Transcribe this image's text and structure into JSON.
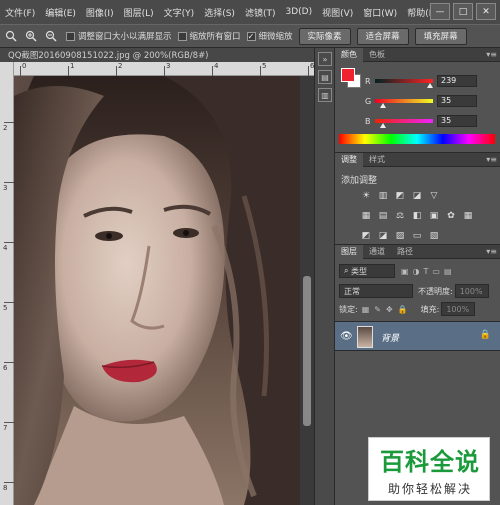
{
  "menu": {
    "items": [
      "文件(F)",
      "编辑(E)",
      "图像(I)",
      "图层(L)",
      "文字(Y)",
      "选择(S)",
      "滤镜(T)",
      "3D(D)",
      "视图(V)",
      "窗口(W)",
      "帮助(H)"
    ],
    "window_controls": [
      "—",
      "□",
      "✕"
    ]
  },
  "options": {
    "resize_windows": "调整窗口大小以满屏显示",
    "zoom_all": "缩放所有窗口",
    "scrubby_zoom": "细微缩放",
    "actual_pixels": "实际像素",
    "fit_screen": "适合屏幕",
    "fill_screen": "填充屏幕"
  },
  "document": {
    "tab_title": "QQ截图20160908151022.jpg @ 200%(RGB/8#)",
    "ruler_top": [
      "0",
      "1",
      "2",
      "3",
      "4",
      "5",
      "6"
    ],
    "ruler_left": [
      "2",
      "3",
      "4",
      "5",
      "6",
      "7",
      "8"
    ]
  },
  "color_panel": {
    "tabs": [
      "颜色",
      "色板"
    ],
    "r": {
      "label": "R",
      "value": "239",
      "fraction": 0.94
    },
    "g": {
      "label": "G",
      "value": "35",
      "fraction": 0.14
    },
    "b": {
      "label": "B",
      "value": "35",
      "fraction": 0.14
    },
    "foreground": "#ef2323",
    "background": "#ffffff"
  },
  "adjust_panel": {
    "tabs": [
      "调整",
      "样式"
    ],
    "title": "添加调整"
  },
  "layers_panel": {
    "tabs": [
      "图层",
      "通道",
      "路径"
    ],
    "filter_kind": "类型",
    "blend_mode": "正常",
    "opacity_label": "不透明度:",
    "opacity_value": "100%",
    "lock_label": "锁定:",
    "fill_label": "填充:",
    "fill_value": "100%",
    "layer_name": "背景"
  },
  "watermark": {
    "title": "百科全说",
    "subtitle": "助你轻松解决"
  },
  "colors": {
    "menubar": "#4a4a4a",
    "panel": "#535353",
    "layer_selected": "#5a6f86",
    "watermark_green": "#1a9a3a"
  }
}
